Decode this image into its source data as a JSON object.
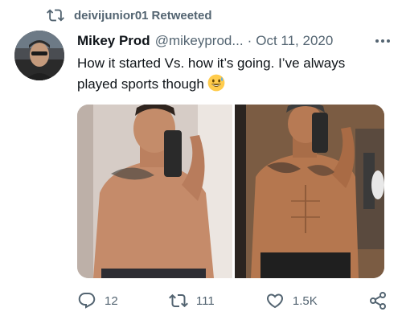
{
  "retweet": {
    "icon": "retweet-icon",
    "user": "deivijunior01",
    "label": "Retweeted"
  },
  "tweet": {
    "author": {
      "display_name": "Mikey Prod",
      "handle": "@mikeyprod...",
      "avatar": "avatar-photo"
    },
    "separator": "·",
    "date": "Oct 11, 2020",
    "more_icon": "more-options-icon",
    "text": "How it started Vs. how it’s going. I’ve always played sports though",
    "emoji": "grinning-sweat-emoji",
    "media": [
      {
        "name": "photo-how-it-started"
      },
      {
        "name": "photo-how-its-going"
      }
    ]
  },
  "actions": {
    "reply": {
      "icon": "reply-icon",
      "count": "12"
    },
    "retweet": {
      "icon": "retweet-icon",
      "count": "111"
    },
    "like": {
      "icon": "heart-icon",
      "count": "1.5K"
    },
    "share": {
      "icon": "share-icon"
    }
  },
  "colors": {
    "text_primary": "#0f1419",
    "text_secondary": "#536471",
    "background": "#ffffff",
    "emoji_yellow": "#ffcc4d"
  }
}
